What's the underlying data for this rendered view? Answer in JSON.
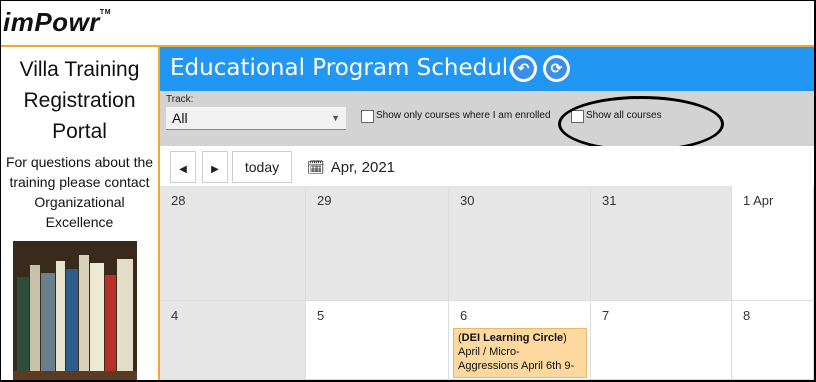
{
  "logo": {
    "text": "imPowr",
    "tm": "TM"
  },
  "sidebar": {
    "title_lines": [
      "Villa Training",
      "Registration",
      "Portal"
    ],
    "contact_lines": [
      "For questions about the",
      "training please contact",
      "Organizational",
      "Excellence"
    ]
  },
  "header": {
    "title": "Educational Program Schedule",
    "back_icon": "undo-arrow-icon",
    "refresh_icon": "refresh-icon"
  },
  "filters": {
    "track_label": "Track:",
    "track_value": "All",
    "enrolled_label": "Show only courses where I am enrolled",
    "all_courses_label": "Show all courses"
  },
  "toolbar": {
    "prev": "◀",
    "next": "▶",
    "today": "today",
    "month": "Apr, 2021"
  },
  "calendar": {
    "week1": [
      "28",
      "29",
      "30",
      "31",
      "1 Apr"
    ],
    "week2": [
      "4",
      "5",
      "6",
      "7",
      "8"
    ],
    "event": {
      "title": "DEI Learning Circle",
      "lines": [
        "April / Micro-",
        "Aggressions April 6th 9-"
      ]
    }
  },
  "colors": {
    "accent": "#f0a830",
    "header": "#2196f3",
    "event": "#fdd9a0"
  }
}
